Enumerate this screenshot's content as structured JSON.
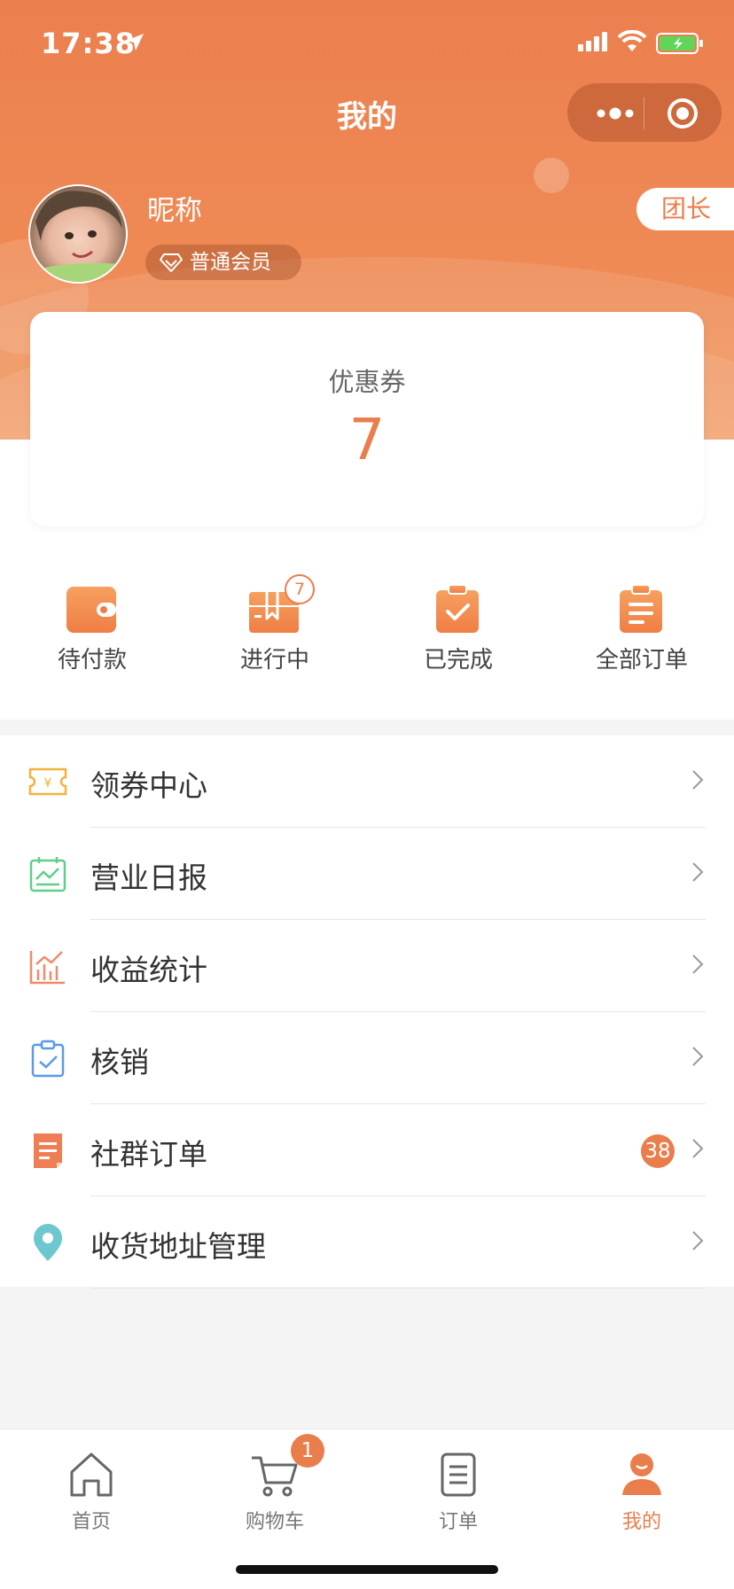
{
  "status_bar": {
    "time": "17:38"
  },
  "nav": {
    "title": "我的"
  },
  "profile": {
    "nickname": "昵称",
    "member_level": "普通会员",
    "role_button": "团长"
  },
  "coupon": {
    "label": "优惠券",
    "count": "7"
  },
  "orders": [
    {
      "label": "待付款",
      "icon": "wallet-icon"
    },
    {
      "label": "进行中",
      "icon": "package-icon",
      "badge": "7"
    },
    {
      "label": "已完成",
      "icon": "clipboard-check-icon"
    },
    {
      "label": "全部订单",
      "icon": "clipboard-list-icon"
    }
  ],
  "menu": [
    {
      "label": "领券中心",
      "icon": "coupon-ticket-icon"
    },
    {
      "label": "营业日报",
      "icon": "daily-report-icon"
    },
    {
      "label": "收益统计",
      "icon": "bar-chart-icon"
    },
    {
      "label": "核销",
      "icon": "verify-clipboard-icon"
    },
    {
      "label": "社群订单",
      "icon": "group-order-icon",
      "badge": "38"
    },
    {
      "label": "收货地址管理",
      "icon": "location-pin-icon"
    }
  ],
  "tabbar": [
    {
      "label": "首页",
      "icon": "home-icon"
    },
    {
      "label": "购物车",
      "icon": "cart-icon",
      "badge": "1"
    },
    {
      "label": "订单",
      "icon": "order-doc-icon"
    },
    {
      "label": "我的",
      "icon": "user-icon",
      "active": true
    }
  ],
  "colors": {
    "accent": "#ea7d4c",
    "header": "#ec7f4f"
  }
}
